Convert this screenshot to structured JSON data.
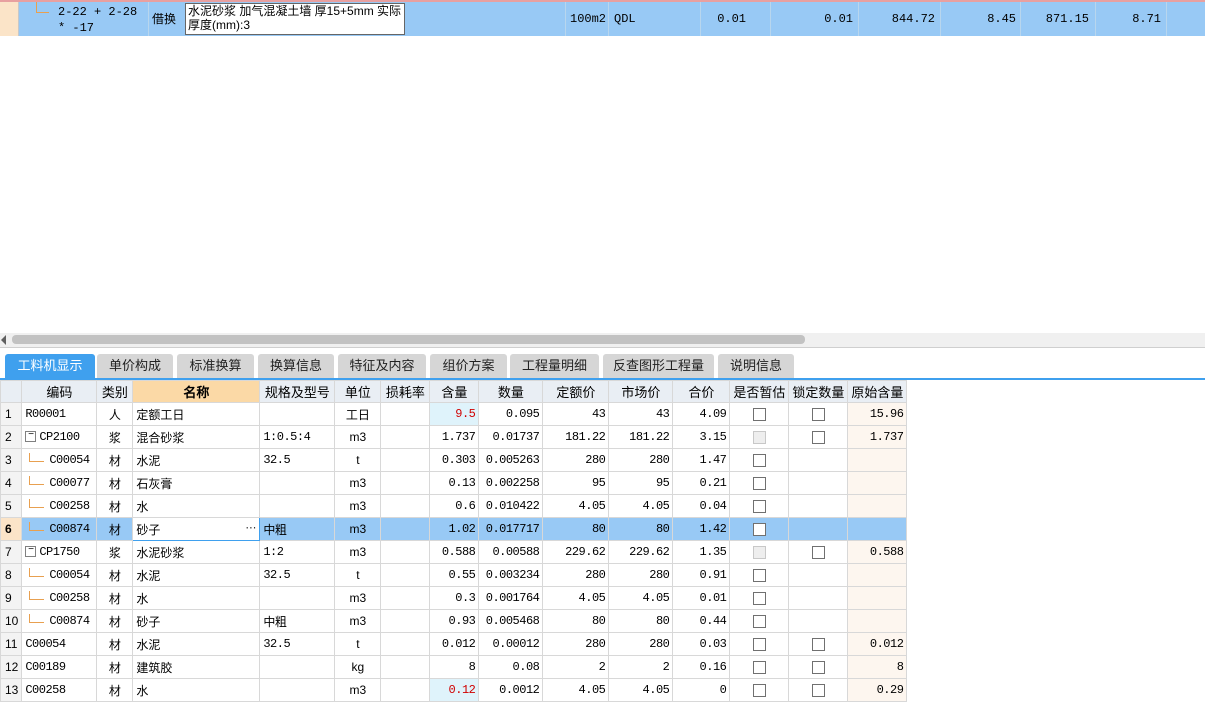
{
  "top_row": {
    "code": "2-22 + 2-28 * -17",
    "type": "借换",
    "name": "水泥砂浆 加气混凝土墙 厚15+5mm  实际厚度(mm):3",
    "unit": "100m2",
    "qty_expr": "QDL",
    "v1": "0.01",
    "v2": "0.01",
    "v3": "844.72",
    "v4": "8.45",
    "v5": "871.15",
    "v6": "8.71"
  },
  "tabs": [
    {
      "label": "工料机显示",
      "active": true
    },
    {
      "label": "单价构成",
      "active": false
    },
    {
      "label": "标准换算",
      "active": false
    },
    {
      "label": "换算信息",
      "active": false
    },
    {
      "label": "特征及内容",
      "active": false
    },
    {
      "label": "组价方案",
      "active": false
    },
    {
      "label": "工程量明细",
      "active": false
    },
    {
      "label": "反查图形工程量",
      "active": false
    },
    {
      "label": "说明信息",
      "active": false
    }
  ],
  "columns": [
    "编码",
    "类别",
    "名称",
    "规格及型号",
    "单位",
    "损耗率",
    "含量",
    "数量",
    "定额价",
    "市场价",
    "合价",
    "是否暂估",
    "锁定数量",
    "原始含量"
  ],
  "rows": [
    {
      "no": "1",
      "code": "R00001",
      "level": 0,
      "expander": "",
      "cat": "人",
      "name": "定额工日",
      "spec": "",
      "unit": "工日",
      "loss": "",
      "content": "9.5",
      "content_hl": true,
      "qty": "0.095",
      "quota": "43",
      "market": "43",
      "total": "4.09",
      "est": "cb",
      "lock": "cb",
      "orig": "15.96"
    },
    {
      "no": "2",
      "code": "CP2100",
      "level": 0,
      "expander": "−",
      "cat": "浆",
      "name": "混合砂浆",
      "spec": "1:0.5:4",
      "unit": "m3",
      "loss": "",
      "content": "1.737",
      "content_hl": false,
      "qty": "0.01737",
      "quota": "181.22",
      "market": "181.22",
      "total": "3.15",
      "est": "dis",
      "lock": "cb",
      "orig": "1.737"
    },
    {
      "no": "3",
      "code": "C00054",
      "level": 1,
      "expander": "",
      "cat": "材",
      "name": "水泥",
      "spec": "32.5",
      "unit": "t",
      "loss": "",
      "content": "0.303",
      "content_hl": false,
      "qty": "0.005263",
      "quota": "280",
      "market": "280",
      "total": "1.47",
      "est": "cb",
      "lock": "",
      "orig": ""
    },
    {
      "no": "4",
      "code": "C00077",
      "level": 1,
      "expander": "",
      "cat": "材",
      "name": "石灰膏",
      "spec": "",
      "unit": "m3",
      "loss": "",
      "content": "0.13",
      "content_hl": false,
      "qty": "0.002258",
      "quota": "95",
      "market": "95",
      "total": "0.21",
      "est": "cb",
      "lock": "",
      "orig": ""
    },
    {
      "no": "5",
      "code": "C00258",
      "level": 1,
      "expander": "",
      "cat": "材",
      "name": "水",
      "spec": "",
      "unit": "m3",
      "loss": "",
      "content": "0.6",
      "content_hl": false,
      "qty": "0.010422",
      "quota": "4.05",
      "market": "4.05",
      "total": "0.04",
      "est": "cb",
      "lock": "",
      "orig": ""
    },
    {
      "no": "6",
      "code": "C00874",
      "level": 1,
      "expander": "",
      "cat": "材",
      "name": "砂子",
      "spec": "中粗",
      "unit": "m3",
      "loss": "",
      "content": "1.02",
      "content_hl": false,
      "qty": "0.017717",
      "quota": "80",
      "market": "80",
      "total": "1.42",
      "est": "cb",
      "lock": "",
      "orig": "",
      "selected": true
    },
    {
      "no": "7",
      "code": "CP1750",
      "level": 0,
      "expander": "−",
      "cat": "浆",
      "name": "水泥砂浆",
      "spec": "1:2",
      "unit": "m3",
      "loss": "",
      "content": "0.588",
      "content_hl": false,
      "qty": "0.00588",
      "quota": "229.62",
      "market": "229.62",
      "total": "1.35",
      "est": "dis",
      "lock": "cb",
      "orig": "0.588"
    },
    {
      "no": "8",
      "code": "C00054",
      "level": 1,
      "expander": "",
      "cat": "材",
      "name": "水泥",
      "spec": "32.5",
      "unit": "t",
      "loss": "",
      "content": "0.55",
      "content_hl": false,
      "qty": "0.003234",
      "quota": "280",
      "market": "280",
      "total": "0.91",
      "est": "cb",
      "lock": "",
      "orig": ""
    },
    {
      "no": "9",
      "code": "C00258",
      "level": 1,
      "expander": "",
      "cat": "材",
      "name": "水",
      "spec": "",
      "unit": "m3",
      "loss": "",
      "content": "0.3",
      "content_hl": false,
      "qty": "0.001764",
      "quota": "4.05",
      "market": "4.05",
      "total": "0.01",
      "est": "cb",
      "lock": "",
      "orig": ""
    },
    {
      "no": "10",
      "code": "C00874",
      "level": 1,
      "expander": "",
      "cat": "材",
      "name": "砂子",
      "spec": "中粗",
      "unit": "m3",
      "loss": "",
      "content": "0.93",
      "content_hl": false,
      "qty": "0.005468",
      "quota": "80",
      "market": "80",
      "total": "0.44",
      "est": "cb",
      "lock": "",
      "orig": ""
    },
    {
      "no": "11",
      "code": "C00054",
      "level": 0,
      "expander": "",
      "cat": "材",
      "name": "水泥",
      "spec": "32.5",
      "unit": "t",
      "loss": "",
      "content": "0.012",
      "content_hl": false,
      "qty": "0.00012",
      "quota": "280",
      "market": "280",
      "total": "0.03",
      "est": "cb",
      "lock": "cb",
      "orig": "0.012"
    },
    {
      "no": "12",
      "code": "C00189",
      "level": 0,
      "expander": "",
      "cat": "材",
      "name": "建筑胶",
      "spec": "",
      "unit": "kg",
      "loss": "",
      "content": "8",
      "content_hl": false,
      "qty": "0.08",
      "quota": "2",
      "market": "2",
      "total": "0.16",
      "est": "cb",
      "lock": "cb",
      "orig": "8"
    },
    {
      "no": "13",
      "code": "C00258",
      "level": 0,
      "expander": "",
      "cat": "材",
      "name": "水",
      "spec": "",
      "unit": "m3",
      "loss": "",
      "content": "0.12",
      "content_hl": true,
      "qty": "0.0012",
      "quota": "4.05",
      "market": "4.05",
      "total": "0",
      "est": "cb",
      "lock": "cb",
      "orig": "0.29"
    }
  ]
}
